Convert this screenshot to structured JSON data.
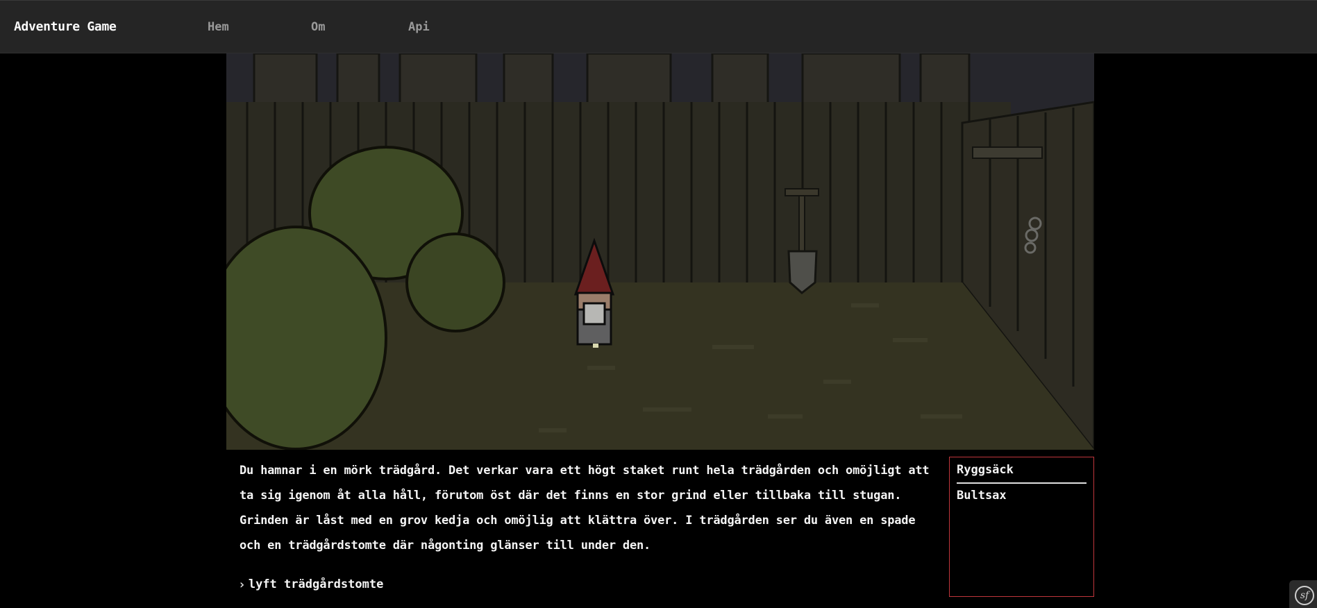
{
  "nav": {
    "brand": "Adventure Game",
    "links": [
      {
        "label": "Hem"
      },
      {
        "label": "Om"
      },
      {
        "label": "Api"
      }
    ]
  },
  "scene": {
    "description_text": "Du hamnar i en mörk trädgård. Det verkar vara ett högt staket runt hela trädgården och omöjligt att ta sig igenom åt alla håll, förutom öst där det finns en stor grind eller tillbaka till stugan. Grinden är låst med en grov kedja och omöjlig att klättra över. I trädgården ser du även en spade och en trädgårdstomte där någonting glänser till under den.",
    "colors": {
      "sky": "#20202a",
      "fence": "#2a2a21",
      "ground": "#33331f",
      "bush": "#3e4a25",
      "gnome_hat": "#6b1f1f"
    }
  },
  "prompt": {
    "chevron": "›",
    "command": "lyft trädgårdstomte"
  },
  "inventory": {
    "title": "Ryggsäck",
    "items": [
      "Bultsax"
    ],
    "border_color": "#c0363c"
  },
  "badge": {
    "icon": "symfony-icon",
    "glyph": "sf"
  }
}
